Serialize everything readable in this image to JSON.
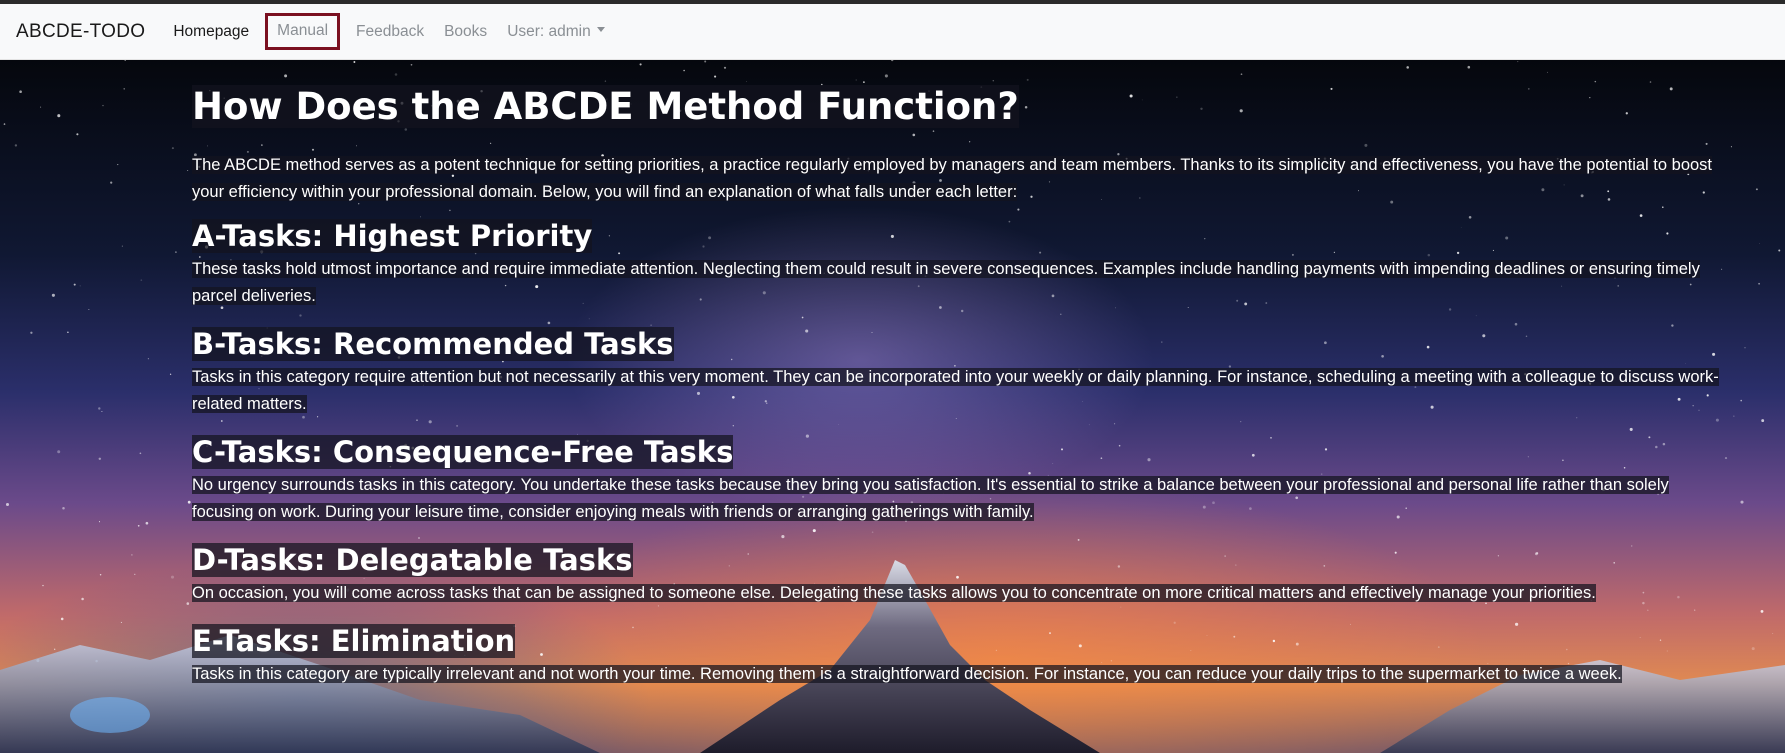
{
  "navbar": {
    "brand": "ABCDE-TODO",
    "items": [
      {
        "label": "Homepage"
      },
      {
        "label": "Manual"
      },
      {
        "label": "Feedback"
      },
      {
        "label": "Books"
      },
      {
        "label": "User: admin"
      }
    ]
  },
  "content": {
    "title": "How Does the ABCDE Method Function?",
    "intro": "The ABCDE method serves as a potent technique for setting priorities, a practice regularly employed by managers and team members. Thanks to its simplicity and effectiveness, you have the potential to boost your efficiency within your professional domain. Below, you will find an explanation of what falls under each letter:",
    "sections": [
      {
        "heading": "A-Tasks: Highest Priority",
        "text": "These tasks hold utmost importance and require immediate attention. Neglecting them could result in severe consequences. Examples include handling payments with impending deadlines or ensuring timely parcel deliveries."
      },
      {
        "heading": "B-Tasks: Recommended Tasks",
        "text": "Tasks in this category require attention but not necessarily at this very moment. They can be incorporated into your weekly or daily planning. For instance, scheduling a meeting with a colleague to discuss work-related matters."
      },
      {
        "heading": "C-Tasks: Consequence-Free Tasks",
        "text": "No urgency surrounds tasks in this category. You undertake these tasks because they bring you satisfaction. It's essential to strike a balance between your professional and personal life rather than solely focusing on work. During your leisure time, consider enjoying meals with friends or arranging gatherings with family."
      },
      {
        "heading": "D-Tasks: Delegatable Tasks",
        "text": "On occasion, you will come across tasks that can be assigned to someone else. Delegating these tasks allows you to concentrate on more critical matters and effectively manage your priorities."
      },
      {
        "heading": "E-Tasks: Elimination",
        "text": "Tasks in this category are typically irrelevant and not worth your time. Removing them is a straightforward decision. For instance, you can reduce your daily trips to the supermarket to twice a week."
      }
    ]
  },
  "colors": {
    "highlight_border": "#7a1020",
    "navbar_bg": "#f8f9fa",
    "text_overlay_bg": "#14141e"
  }
}
